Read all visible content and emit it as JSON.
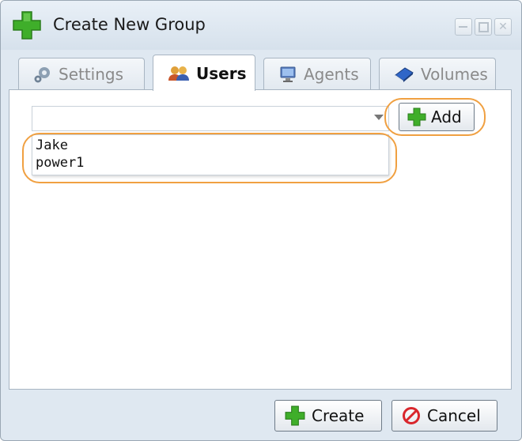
{
  "window": {
    "title": "Create New Group",
    "controls": [
      "minimize-icon",
      "maximize-icon",
      "close-icon"
    ]
  },
  "tabs": [
    {
      "label": "Settings",
      "icon": "gear-icon",
      "active": false
    },
    {
      "label": "Users",
      "icon": "users-icon",
      "active": true
    },
    {
      "label": "Agents",
      "icon": "monitor-icon",
      "active": false
    },
    {
      "label": "Volumes",
      "icon": "book-icon",
      "active": false
    }
  ],
  "users_panel": {
    "combo_value": "",
    "add_label": "Add",
    "dropdown_items": [
      "Jake",
      "power1"
    ]
  },
  "footer": {
    "create_label": "Create",
    "cancel_label": "Cancel"
  },
  "colors": {
    "highlight": "#f0a041",
    "plus_green": "#3fae2a",
    "cancel_red": "#d9262c"
  }
}
